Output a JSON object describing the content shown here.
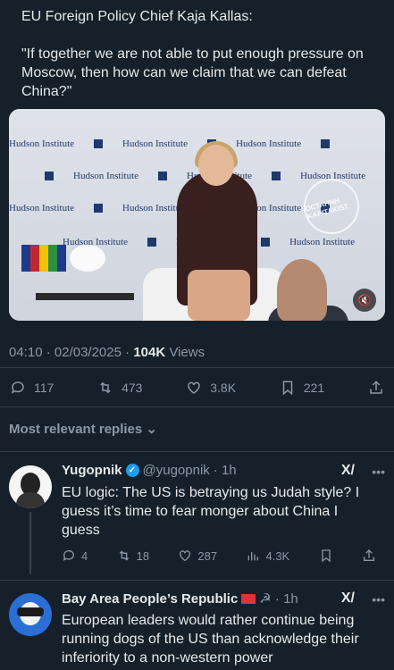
{
  "post": {
    "line1": "EU Foreign Policy Chief Kaja Kallas:",
    "quote": "\"If together we are not able to put enough pressure on Moscow, then how can we claim that we can defeat China?\""
  },
  "media": {
    "banner_text": "Hudson Institute",
    "stamp_text": "OCTAHNH KAPITAKIST",
    "mute_icon": "mute-icon"
  },
  "meta": {
    "time": "04:10",
    "sep": " · ",
    "date": "02/03/2025",
    "sep2": " · ",
    "views_count": "104K",
    "views_label": " Views"
  },
  "actions": {
    "replies": "117",
    "reposts": "473",
    "likes": "3.8K",
    "bookmarks": "221"
  },
  "sort_label": "Most relevant replies",
  "replies": [
    {
      "name": "Yugopnik",
      "handle": "@yugopnik",
      "time": "· 1h",
      "text": "EU logic: The US is betraying us Judah style? I guess it’s time to fear monger about China I guess",
      "replies": "4",
      "reposts": "18",
      "likes": "287",
      "views": "4.3K"
    },
    {
      "name": "Bay Area People’s Republic",
      "handle": "",
      "time": "☭ · 1h",
      "text": "European leaders would rather continue being running dogs of the US than acknowledge their inferiority to a non-western power"
    }
  ],
  "colors": {
    "background": "#15202b",
    "text": "#e7e9ea",
    "muted": "#8b98a5",
    "accent": "#1d9bf0"
  }
}
